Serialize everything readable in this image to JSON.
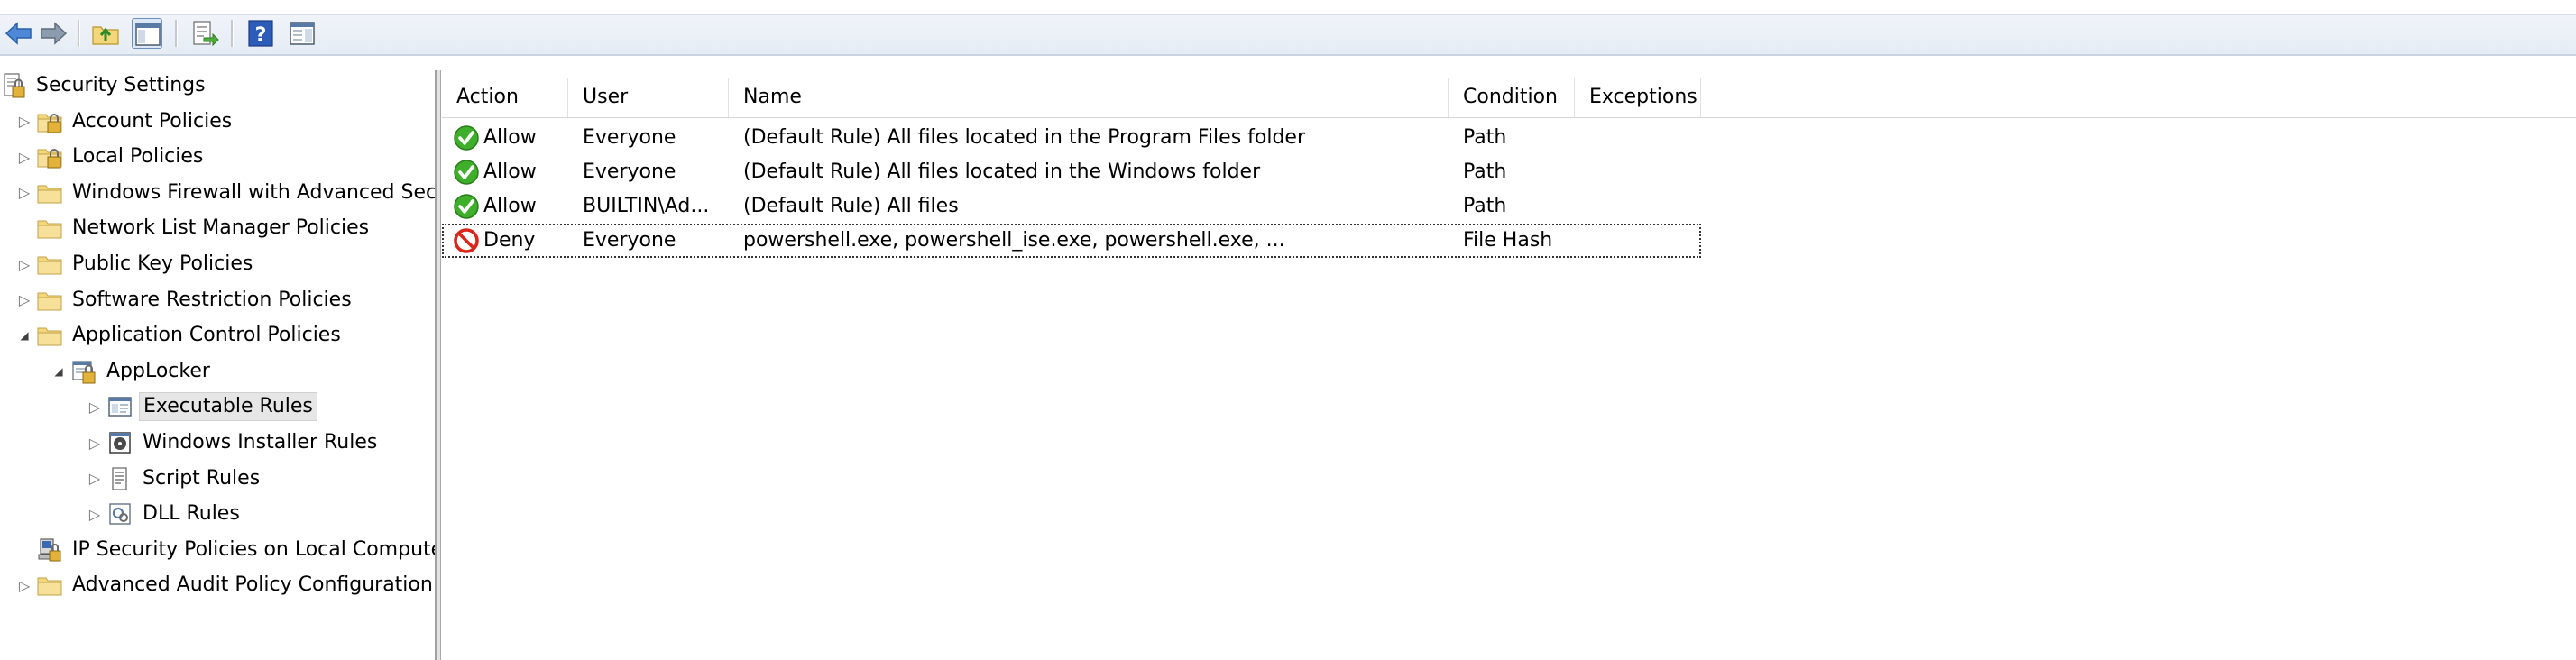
{
  "toolbar": {
    "buttons": [
      {
        "icon": "back-arrow-icon"
      },
      {
        "icon": "forward-arrow-icon"
      },
      {
        "icon": "up-folder-icon"
      },
      {
        "icon": "show-hide-console-tree-icon"
      },
      {
        "icon": "export-list-icon"
      },
      {
        "icon": "help-icon"
      },
      {
        "icon": "show-hide-action-pane-icon"
      }
    ]
  },
  "tree": {
    "items": [
      {
        "label": "Security Settings",
        "level": 0,
        "arrow": "",
        "icon": "security-settings-icon"
      },
      {
        "label": "Account Policies",
        "level": 1,
        "arrow": "collapsed",
        "icon": "policy-folder-lock-icon"
      },
      {
        "label": "Local Policies",
        "level": 1,
        "arrow": "collapsed",
        "icon": "policy-folder-lock-icon"
      },
      {
        "label": "Windows Firewall with Advanced Security",
        "level": 1,
        "arrow": "collapsed",
        "icon": "folder-icon"
      },
      {
        "label": "Network List Manager Policies",
        "level": 1,
        "arrow": "",
        "icon": "folder-icon"
      },
      {
        "label": "Public Key Policies",
        "level": 1,
        "arrow": "collapsed",
        "icon": "folder-icon"
      },
      {
        "label": "Software Restriction Policies",
        "level": 1,
        "arrow": "collapsed",
        "icon": "folder-icon"
      },
      {
        "label": "Application Control Policies",
        "level": 1,
        "arrow": "expanded",
        "icon": "folder-icon"
      },
      {
        "label": "AppLocker",
        "level": 2,
        "arrow": "expanded",
        "icon": "applocker-icon"
      },
      {
        "label": "Executable Rules",
        "level": 3,
        "arrow": "collapsed",
        "icon": "executable-rules-icon",
        "selected": true
      },
      {
        "label": "Windows Installer Rules",
        "level": 3,
        "arrow": "collapsed",
        "icon": "installer-rules-icon"
      },
      {
        "label": "Script Rules",
        "level": 3,
        "arrow": "collapsed",
        "icon": "script-rules-icon"
      },
      {
        "label": "DLL Rules",
        "level": 3,
        "arrow": "collapsed",
        "icon": "dll-rules-icon"
      },
      {
        "label": "IP Security Policies on Local Computer",
        "level": 1,
        "arrow": "",
        "icon": "ip-security-icon"
      },
      {
        "label": "Advanced Audit Policy Configuration",
        "level": 1,
        "arrow": "collapsed",
        "icon": "folder-icon"
      }
    ]
  },
  "list": {
    "columns": [
      "Action",
      "User",
      "Name",
      "Condition",
      "Exceptions"
    ],
    "rows": [
      {
        "action": "Allow",
        "action_icon": "allow-check-icon",
        "user": "Everyone",
        "name": "(Default Rule) All files located in the Program Files folder",
        "condition": "Path",
        "exceptions": ""
      },
      {
        "action": "Allow",
        "action_icon": "allow-check-icon",
        "user": "Everyone",
        "name": "(Default Rule) All files located in the Windows folder",
        "condition": "Path",
        "exceptions": ""
      },
      {
        "action": "Allow",
        "action_icon": "allow-check-icon",
        "user": "BUILTIN\\Ad...",
        "name": "(Default Rule) All files",
        "condition": "Path",
        "exceptions": ""
      },
      {
        "action": "Deny",
        "action_icon": "deny-circle-icon",
        "user": "Everyone",
        "name": "powershell.exe, powershell_ise.exe, powershell.exe, ...",
        "condition": "File Hash",
        "exceptions": "",
        "focused": true
      }
    ]
  },
  "colors": {
    "allow_green": "#3fae2a",
    "deny_red": "#d9261c",
    "folder_yellow": "#f3d77a"
  }
}
